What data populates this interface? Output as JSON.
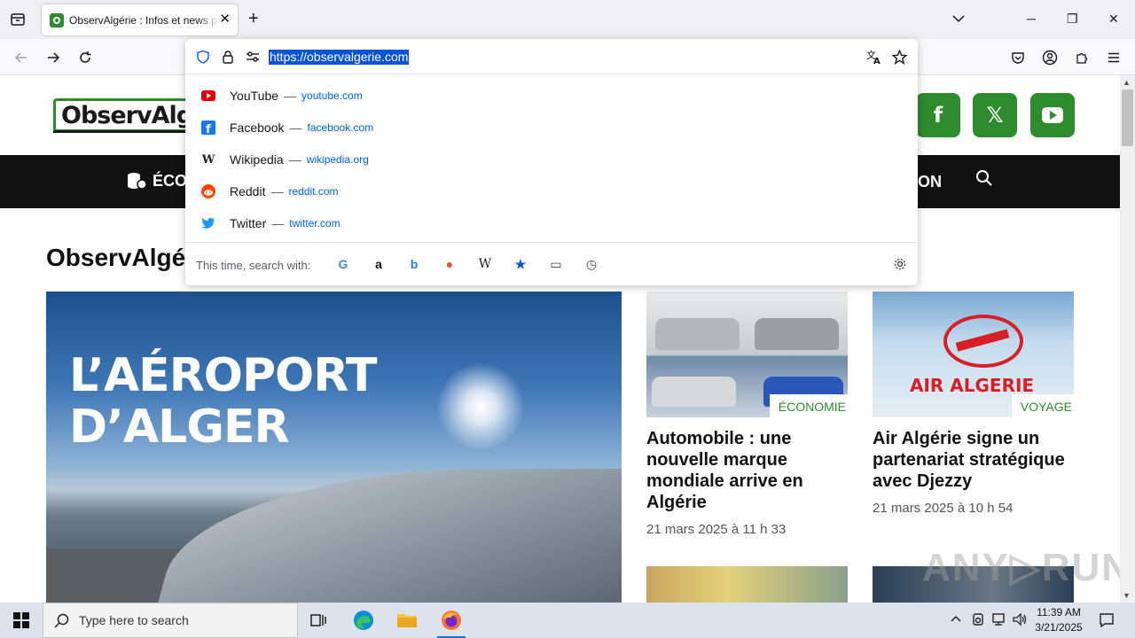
{
  "browser": {
    "tab": {
      "title": "ObservAlgérie : Infos et news pour l'Algérie",
      "close": "✕"
    },
    "new_tab": "+",
    "window_controls": {
      "minimize": "─",
      "restore": "❐",
      "close": "✕"
    },
    "url": "https://observalgerie.com"
  },
  "url_dropdown": {
    "suggestions": [
      {
        "name": "YouTube",
        "dash": "—",
        "url": "youtube.com",
        "icon": "youtube-icon",
        "color": "#e00000"
      },
      {
        "name": "Facebook",
        "dash": "—",
        "url": "facebook.com",
        "icon": "facebook-icon",
        "color": "#1877f2"
      },
      {
        "name": "Wikipedia",
        "dash": "—",
        "url": "wikipedia.org",
        "icon": "wikipedia-icon",
        "color": "#222222"
      },
      {
        "name": "Reddit",
        "dash": "—",
        "url": "reddit.com",
        "icon": "reddit-icon",
        "color": "#ff4500"
      },
      {
        "name": "Twitter",
        "dash": "—",
        "url": "twitter.com",
        "icon": "twitter-icon",
        "color": "#1d9bf0"
      }
    ],
    "search_with_label": "This time, search with:",
    "engines": [
      {
        "name": "google-icon",
        "glyph": "G",
        "color": "#4285f4"
      },
      {
        "name": "amazon-icon",
        "glyph": "a",
        "color": "#111111"
      },
      {
        "name": "bing-icon",
        "glyph": "b",
        "color": "#1b7ee8"
      },
      {
        "name": "duckduckgo-icon",
        "glyph": "●",
        "color": "#de5833"
      },
      {
        "name": "wikipedia-search-icon",
        "glyph": "W",
        "color": "#222222"
      },
      {
        "name": "bookmarks-icon",
        "glyph": "★",
        "color": "#0a54d6"
      },
      {
        "name": "tabs-icon",
        "glyph": "▭",
        "color": "#444444"
      },
      {
        "name": "history-icon",
        "glyph": "◷",
        "color": "#444444"
      }
    ]
  },
  "page": {
    "logo": "ObservAlg",
    "social": {
      "facebook": "f",
      "x": "𝕏",
      "youtube": "▶"
    },
    "menu": {
      "economy": "ÉCO",
      "right": "ON"
    },
    "section_title": "ObservAlgé",
    "hero_headline": [
      "L’AÉROPORT",
      "D’ALGER"
    ],
    "cards": [
      {
        "category": "ÉCONOMIE",
        "title": "Automobile : une nouvelle marque mondiale arrive en Algérie",
        "date": "21 mars 2025 à 11 h 33"
      },
      {
        "category": "VOYAGE",
        "title": "Air Algérie signe un partenariat stratégique avec Djezzy",
        "date": "21 mars 2025 à 10 h 54",
        "image_text": "AIR ALGERIE"
      }
    ],
    "watermark": "ANY▷RUN"
  },
  "taskbar": {
    "search_placeholder": "Type here to search",
    "time": "11:39 AM",
    "date": "3/21/2025"
  },
  "colors": {
    "brand_green": "#2e8b2e",
    "selection_blue": "#0a54d6",
    "link_blue": "#0061e0"
  }
}
